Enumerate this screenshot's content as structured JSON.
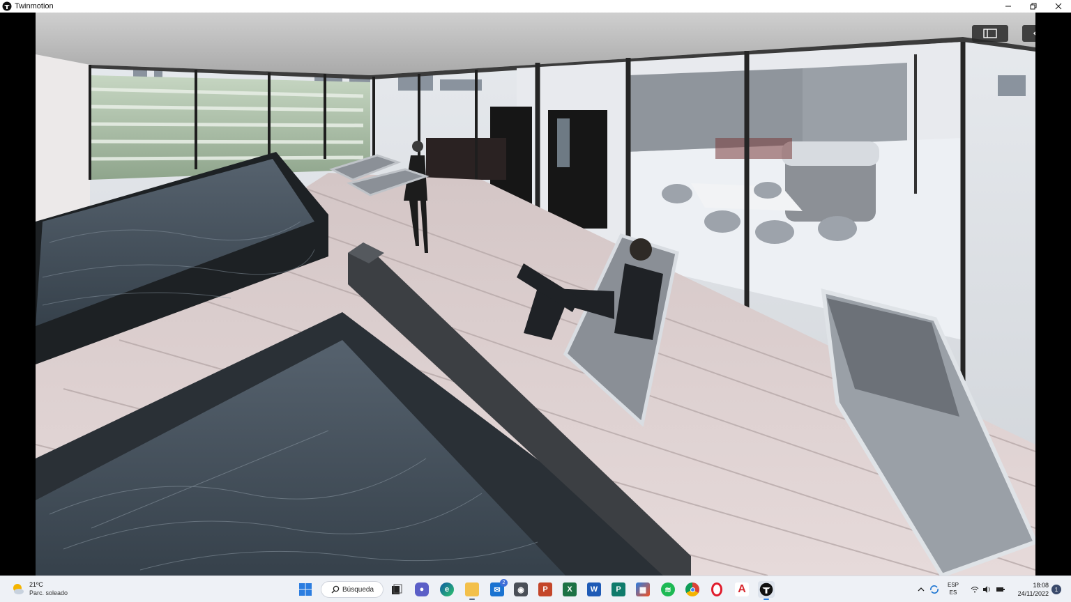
{
  "window": {
    "title": "Twinmotion",
    "icon": "twinmotion-logo-icon",
    "controls": [
      "minimize-icon",
      "restore-icon",
      "close-icon"
    ]
  },
  "viewport": {
    "buttons": [
      {
        "name": "panel-toggle-button",
        "icon": "sidebar-panel-icon"
      },
      {
        "name": "view-mode-button",
        "icon": "eye-icon"
      }
    ]
  },
  "taskbar": {
    "weather": {
      "temp": "21ºC",
      "desc": "Parc. soleado",
      "icon": "partly-sunny-icon"
    },
    "search_label": "Búsqueda",
    "apps": [
      {
        "name": "start",
        "icon": "windows-start-icon"
      },
      {
        "name": "task-view",
        "icon": "task-view-icon"
      },
      {
        "name": "chat",
        "icon": "chat-icon"
      },
      {
        "name": "edge",
        "icon": "edge-browser-icon"
      },
      {
        "name": "file-explorer",
        "icon": "folder-icon"
      },
      {
        "name": "mail",
        "icon": "mail-icon",
        "badge": "2"
      },
      {
        "name": "camera",
        "icon": "camera-icon"
      },
      {
        "name": "powerpoint",
        "icon": "powerpoint-icon",
        "letter": "P"
      },
      {
        "name": "excel",
        "icon": "excel-icon",
        "letter": "X"
      },
      {
        "name": "word",
        "icon": "word-icon",
        "letter": "W"
      },
      {
        "name": "publisher",
        "icon": "publisher-icon",
        "letter": "P"
      },
      {
        "name": "store",
        "icon": "store-icon"
      },
      {
        "name": "spotify",
        "icon": "spotify-icon"
      },
      {
        "name": "chrome",
        "icon": "chrome-icon"
      },
      {
        "name": "opera",
        "icon": "opera-icon"
      },
      {
        "name": "acrobat",
        "icon": "acrobat-icon"
      },
      {
        "name": "twinmotion",
        "icon": "twinmotion-icon"
      }
    ],
    "tray": {
      "lang_top": "ESP",
      "lang_bottom": "ES",
      "time": "18:08",
      "date": "24/11/2022",
      "notifications": "1"
    }
  },
  "colors": {
    "accent": "#3f6fd8",
    "titlebar": "#ffffff",
    "taskbar": "#eef1f6"
  }
}
